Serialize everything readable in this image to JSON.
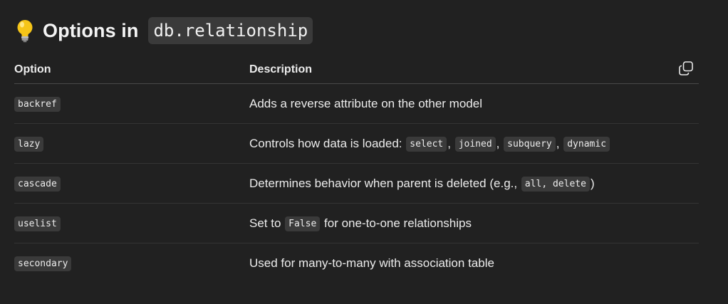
{
  "heading": {
    "icon": "lightbulb-icon",
    "text": "Options in",
    "code": "db.relationship"
  },
  "table": {
    "headers": {
      "option": "Option",
      "description": "Description"
    },
    "copy_icon": "copy-icon",
    "rows": [
      {
        "option": "backref",
        "description": {
          "text": "Adds a reverse attribute on the other model"
        }
      },
      {
        "option": "lazy",
        "description": {
          "prefix": "Controls how data is loaded:",
          "codes": [
            "select",
            "joined",
            "subquery",
            "dynamic"
          ],
          "separator": ","
        }
      },
      {
        "option": "cascade",
        "description": {
          "prefix": "Determines behavior when parent is deleted (e.g.,",
          "code": "all, delete",
          "suffix": ")"
        }
      },
      {
        "option": "uselist",
        "description": {
          "prefix": "Set to",
          "code": "False",
          "suffix": "for one-to-one relationships"
        }
      },
      {
        "option": "secondary",
        "description": {
          "text": "Used for many-to-many with association table"
        }
      }
    ]
  },
  "colors": {
    "background": "#212121",
    "code_background": "#3a3a3a",
    "text": "#ececec",
    "bulb": "#f5c518"
  }
}
